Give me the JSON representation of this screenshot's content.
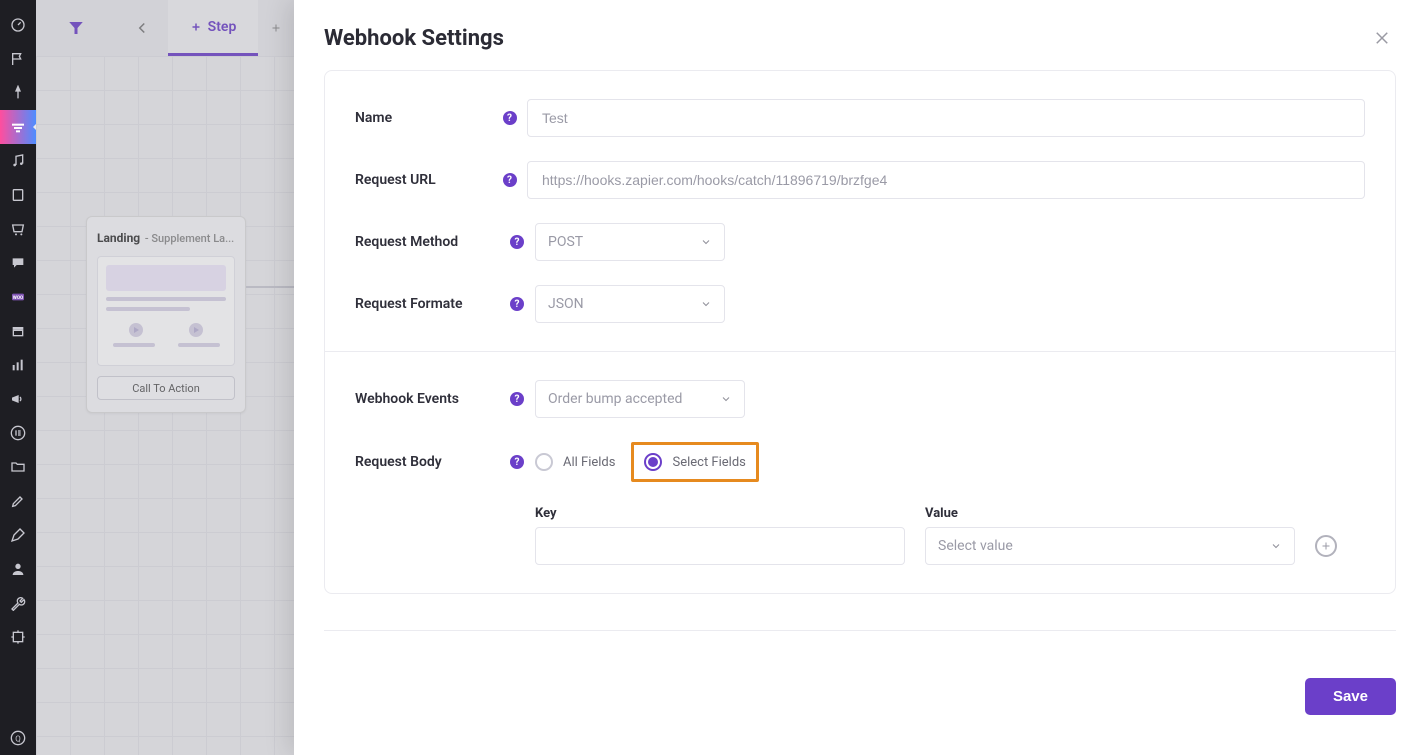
{
  "topTabs": {
    "stepLabel": "Step"
  },
  "canvas": {
    "node": {
      "titlePrefix": "Landing",
      "titleSuffix": " - Supplement La...",
      "ctaLabel": "Call To Action"
    }
  },
  "modal": {
    "title": "Webhook Settings",
    "saveLabel": "Save",
    "fields": {
      "name": {
        "label": "Name",
        "value": "Test"
      },
      "requestUrl": {
        "label": "Request URL",
        "value": "https://hooks.zapier.com/hooks/catch/11896719/brzfge4"
      },
      "requestMethod": {
        "label": "Request Method",
        "value": "POST"
      },
      "requestFormat": {
        "label": "Request Formate",
        "value": "JSON"
      },
      "webhookEvents": {
        "label": "Webhook Events",
        "value": "Order bump accepted"
      },
      "requestBody": {
        "label": "Request Body",
        "options": {
          "all": "All Fields",
          "select": "Select Fields"
        },
        "selected": "select"
      }
    },
    "kv": {
      "keyLabel": "Key",
      "valueLabel": "Value",
      "keyValue": "",
      "valuePlaceholder": "Select value"
    }
  },
  "helpGlyph": "?"
}
